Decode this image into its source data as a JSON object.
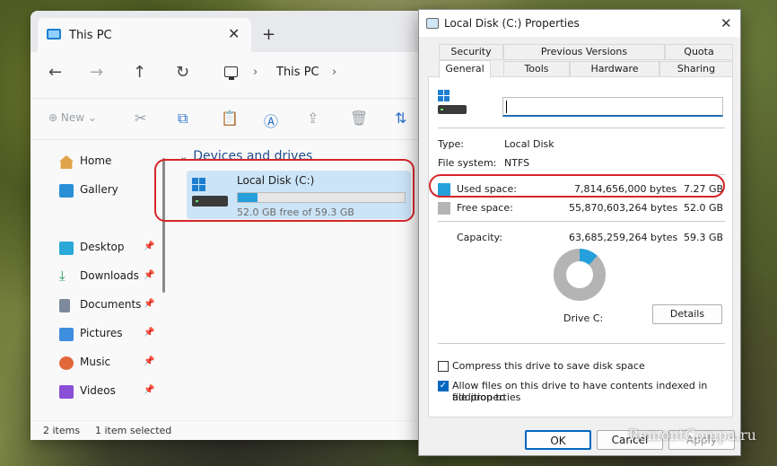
{
  "explorer": {
    "tab_title": "This PC",
    "new_tab_symbol": "+",
    "close_symbol": "✕",
    "breadcrumb": {
      "location": "This PC",
      "separator": "›"
    },
    "toolbar": {
      "new_label": "New"
    },
    "sidebar": {
      "items": [
        {
          "label": "Home",
          "icon": "home-icon",
          "pinned": false
        },
        {
          "label": "Gallery",
          "icon": "gallery-icon",
          "pinned": false
        },
        {
          "label": "Desktop",
          "icon": "desktop-icon",
          "pinned": true
        },
        {
          "label": "Downloads",
          "icon": "downloads-icon",
          "pinned": true
        },
        {
          "label": "Documents",
          "icon": "documents-icon",
          "pinned": true
        },
        {
          "label": "Pictures",
          "icon": "pictures-icon",
          "pinned": true
        },
        {
          "label": "Music",
          "icon": "music-icon",
          "pinned": true
        },
        {
          "label": "Videos",
          "icon": "videos-icon",
          "pinned": true
        }
      ]
    },
    "group_header": "Devices and drives",
    "drive": {
      "name": "Local Disk (C:)",
      "free_text": "52.0 GB free of 59.3 GB",
      "used_fraction": 0.12
    },
    "status": {
      "items": "2 items",
      "selected": "1 item selected"
    }
  },
  "dialog": {
    "title": "Local Disk (C:) Properties",
    "tabs_row1": [
      "Security",
      "Previous Versions",
      "Quota"
    ],
    "tabs_row2": [
      "General",
      "Tools",
      "Hardware",
      "Sharing"
    ],
    "active_tab": "General",
    "name_value": "",
    "type_label": "Type:",
    "type_value": "Local Disk",
    "fs_label": "File system:",
    "fs_value": "NTFS",
    "used_label": "Used space:",
    "used_bytes": "7,814,656,000 bytes",
    "used_gb": "7.27 GB",
    "free_label": "Free space:",
    "free_bytes": "55,870,603,264 bytes",
    "free_gb": "52.0 GB",
    "capacity_label": "Capacity:",
    "capacity_bytes": "63,685,259,264 bytes",
    "capacity_gb": "59.3 GB",
    "drive_label": "Drive C:",
    "details_button": "Details",
    "compress_label": "Compress this drive to save disk space",
    "compress_checked": false,
    "index_label_line1": "Allow files on this drive to have contents indexed in addition to",
    "index_label_line2": "file properties",
    "index_checked": true,
    "ok_button": "OK",
    "cancel_button": "Cancel",
    "apply_button": "Apply",
    "used_color": "#26a0da",
    "free_color": "#b4b4b4",
    "used_fraction": 0.12
  },
  "watermark": "RemontCompa.ru"
}
